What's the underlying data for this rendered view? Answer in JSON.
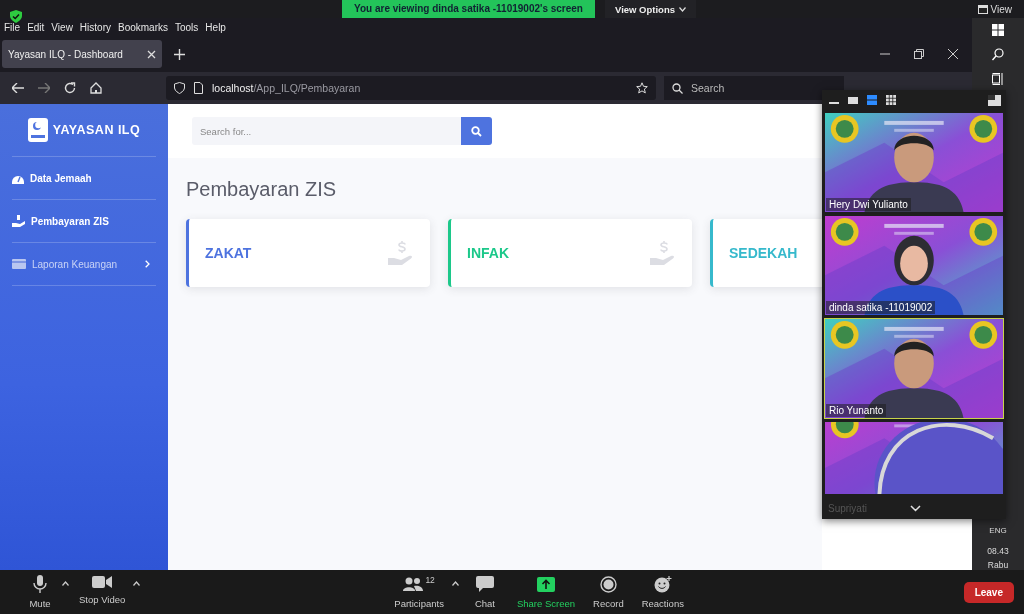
{
  "zoom_bar": {
    "banner": "You are viewing dinda satika -11019002's screen",
    "view_options": "View Options",
    "view": "View"
  },
  "browser": {
    "menu": [
      "File",
      "Edit",
      "View",
      "History",
      "Bookmarks",
      "Tools",
      "Help"
    ],
    "tabs": [
      {
        "title": "Yayasan ILQ - Dashboard",
        "selected": true
      }
    ],
    "url_host": "localhost",
    "url_path": "/App_ILQ/Pembayaran",
    "search_placeholder": "Search"
  },
  "app": {
    "brand": "YAYASAN ILQ",
    "sidebar": [
      {
        "label": "Data Jemaah",
        "kind": "gauge"
      },
      {
        "label": "Pembayaran ZIS",
        "kind": "hand"
      },
      {
        "label": "Laporan Keuangan",
        "kind": "collapsible"
      }
    ],
    "search_placeholder": "Search for...",
    "page_title": "Pembayaran ZIS",
    "cards": [
      {
        "label": "ZAKAT",
        "color": "#4e73df"
      },
      {
        "label": "INFAK",
        "color": "#1cc88a"
      },
      {
        "label": "SEDEKAH",
        "color": "#36b9cc"
      }
    ]
  },
  "video_panel": {
    "view_modes": [
      {
        "selected": false
      },
      {
        "selected": false
      },
      {
        "selected": true
      },
      {
        "selected": false
      }
    ],
    "participants": [
      {
        "name": "Hery Dwi Yulianto",
        "speaking": false
      },
      {
        "name": "dinda satika -11019002",
        "speaking": false
      },
      {
        "name": "Rio Yunanto",
        "speaking": true
      },
      {
        "name": "Supriyati",
        "speaking": false
      }
    ]
  },
  "taskbar": {
    "language": "ENG",
    "time": "08.43",
    "day": "Rabu"
  },
  "toolbar": {
    "items": [
      {
        "label": "Mute",
        "kind": "mic"
      },
      {
        "label": "Stop Video",
        "kind": "camera"
      },
      {
        "label": "Participants",
        "kind": "people",
        "count": "12"
      },
      {
        "label": "Chat",
        "kind": "chat"
      },
      {
        "label": "Share Screen",
        "kind": "share"
      },
      {
        "label": "Record",
        "kind": "record"
      },
      {
        "label": "Reactions",
        "kind": "reactions"
      }
    ],
    "leave": "Leave"
  }
}
